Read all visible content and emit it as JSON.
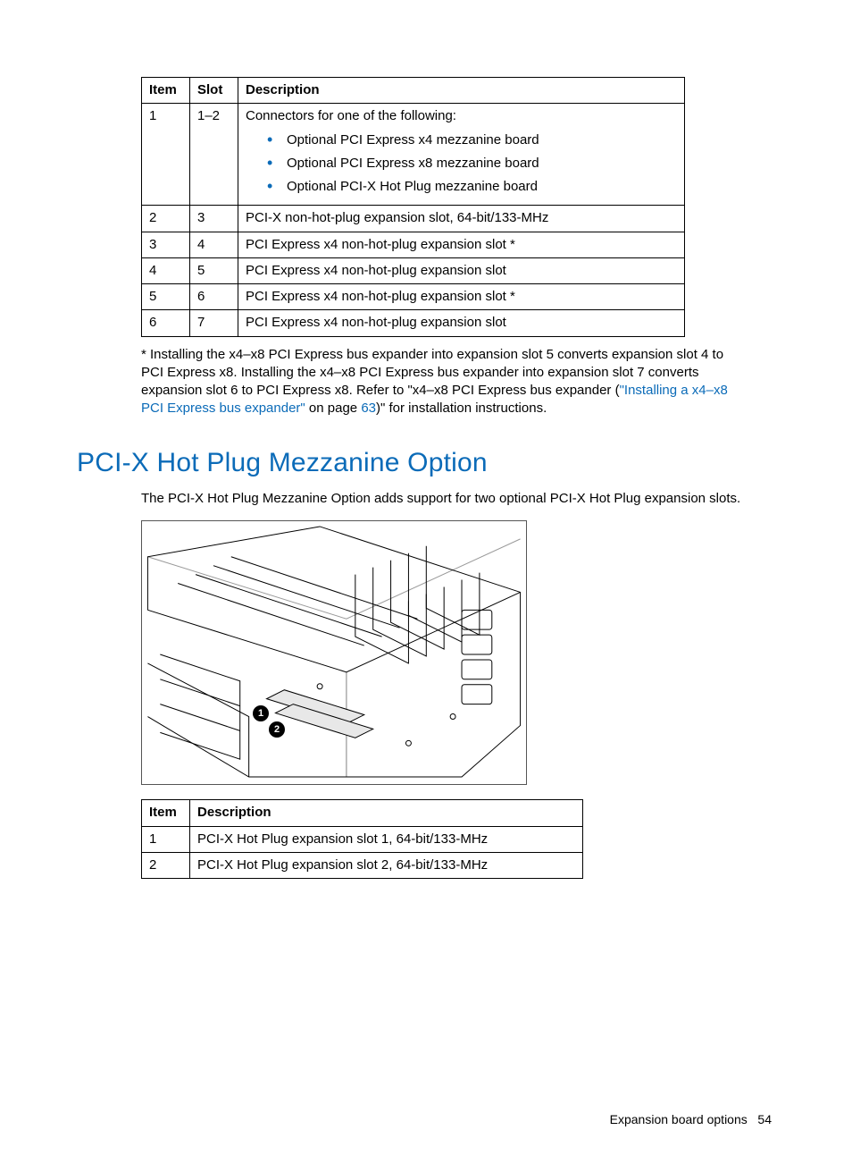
{
  "table1": {
    "headers": {
      "item": "Item",
      "slot": "Slot",
      "desc": "Description"
    },
    "rows": [
      {
        "item": "1",
        "slot": "1–2",
        "desc_intro": "Connectors for one of the following:",
        "desc_list": [
          "Optional PCI Express x4 mezzanine board",
          "Optional PCI Express x8 mezzanine board",
          "Optional PCI-X Hot Plug mezzanine board"
        ]
      },
      {
        "item": "2",
        "slot": "3",
        "desc": "PCI-X non-hot-plug expansion slot, 64-bit/133-MHz"
      },
      {
        "item": "3",
        "slot": "4",
        "desc": "PCI Express x4 non-hot-plug expansion slot *"
      },
      {
        "item": "4",
        "slot": "5",
        "desc": "PCI Express x4 non-hot-plug expansion slot"
      },
      {
        "item": "5",
        "slot": "6",
        "desc": "PCI Express x4 non-hot-plug expansion slot *"
      },
      {
        "item": "6",
        "slot": "7",
        "desc": "PCI Express x4 non-hot-plug expansion slot"
      }
    ]
  },
  "footnote": {
    "part1": "* Installing the x4–x8 PCI Express bus expander into expansion slot 5 converts expansion slot 4 to PCI Express x8. Installing the x4–x8 PCI Express bus expander into expansion slot 7 converts expansion slot 6 to PCI Express x8. Refer to \"x4–x8 PCI Express bus expander (",
    "link1": "\"Installing a x4–x8 PCI Express bus expander\"",
    "part2": " on page ",
    "link2": "63",
    "part3": ")\" for installation instructions."
  },
  "section_title": "PCI-X Hot Plug Mezzanine Option",
  "intro": "The PCI-X Hot Plug Mezzanine Option adds support for two optional PCI-X Hot Plug expansion slots.",
  "callouts": {
    "c1": "1",
    "c2": "2"
  },
  "table2": {
    "headers": {
      "item": "Item",
      "desc": "Description"
    },
    "rows": [
      {
        "item": "1",
        "desc": "PCI-X Hot Plug expansion slot 1, 64-bit/133-MHz"
      },
      {
        "item": "2",
        "desc": "PCI-X Hot Plug expansion slot 2, 64-bit/133-MHz"
      }
    ]
  },
  "footer": {
    "section": "Expansion board options",
    "page": "54"
  }
}
